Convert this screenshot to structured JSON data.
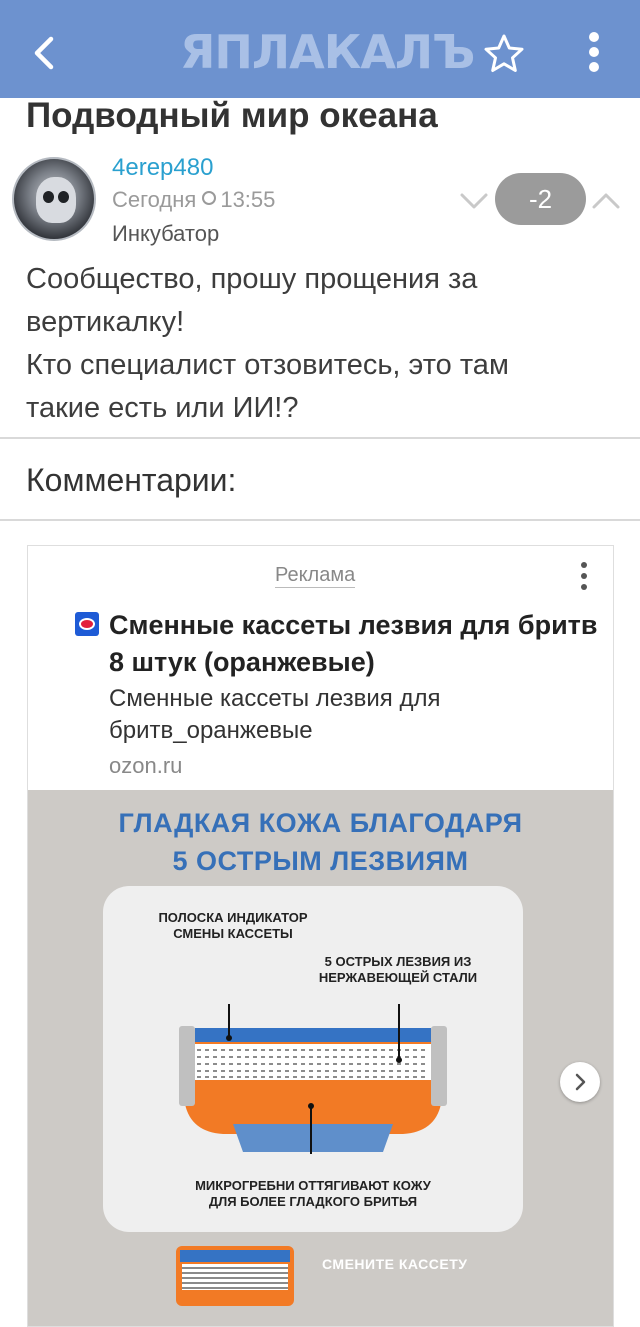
{
  "app": {
    "logo_text": "ЯПЛАКАЛЪ",
    "back_icon": "chevron-left-icon",
    "favorite_icon": "star-outline-icon",
    "menu_icon": "more-vertical-icon",
    "brand_color": "#6d92cf"
  },
  "post": {
    "title": "Подводный мир океана",
    "author": "4erep480",
    "time_label": "Сегодня",
    "time": "13:55",
    "status": "Инкубатор",
    "score": "-2",
    "text_lines": [
      "Сообщество, прошу прощения за",
      "вертикалку!",
      "Кто специалист отзовитесь, это там",
      "такие есть или ИИ!?"
    ]
  },
  "comments": {
    "heading": "Комментарии:"
  },
  "ad": {
    "label": "Реклама",
    "headline": "Сменные кассеты лезвия для бритв 8 штук (оранжевые)",
    "description": "Сменные кассеты лезвия для бритв_оранжевые",
    "domain": "ozon.ru",
    "image_title_line1": "ГЛАДКАЯ КОЖА БЛАГОДАРЯ",
    "image_title_line2": "5 ОСТРЫМ ЛЕЗВИЯМ",
    "caption_indicator_1": "ПОЛОСКА ИНДИКАТОР",
    "caption_indicator_2": "СМЕНЫ КАССЕТЫ",
    "caption_blades_1": "5 ОСТРЫХ ЛЕЗВИЯ ИЗ",
    "caption_blades_2": "НЕРЖАВЕЮЩЕЙ СТАЛИ",
    "caption_micro_1": "МИКРОГРЕБНИ ОТТЯГИВАЮТ КОЖУ",
    "caption_micro_2": "ДЛЯ БОЛЕЕ ГЛАДКОГО БРИТЬЯ",
    "thumb_caption": "СМЕНИТЕ КАССЕТУ"
  }
}
